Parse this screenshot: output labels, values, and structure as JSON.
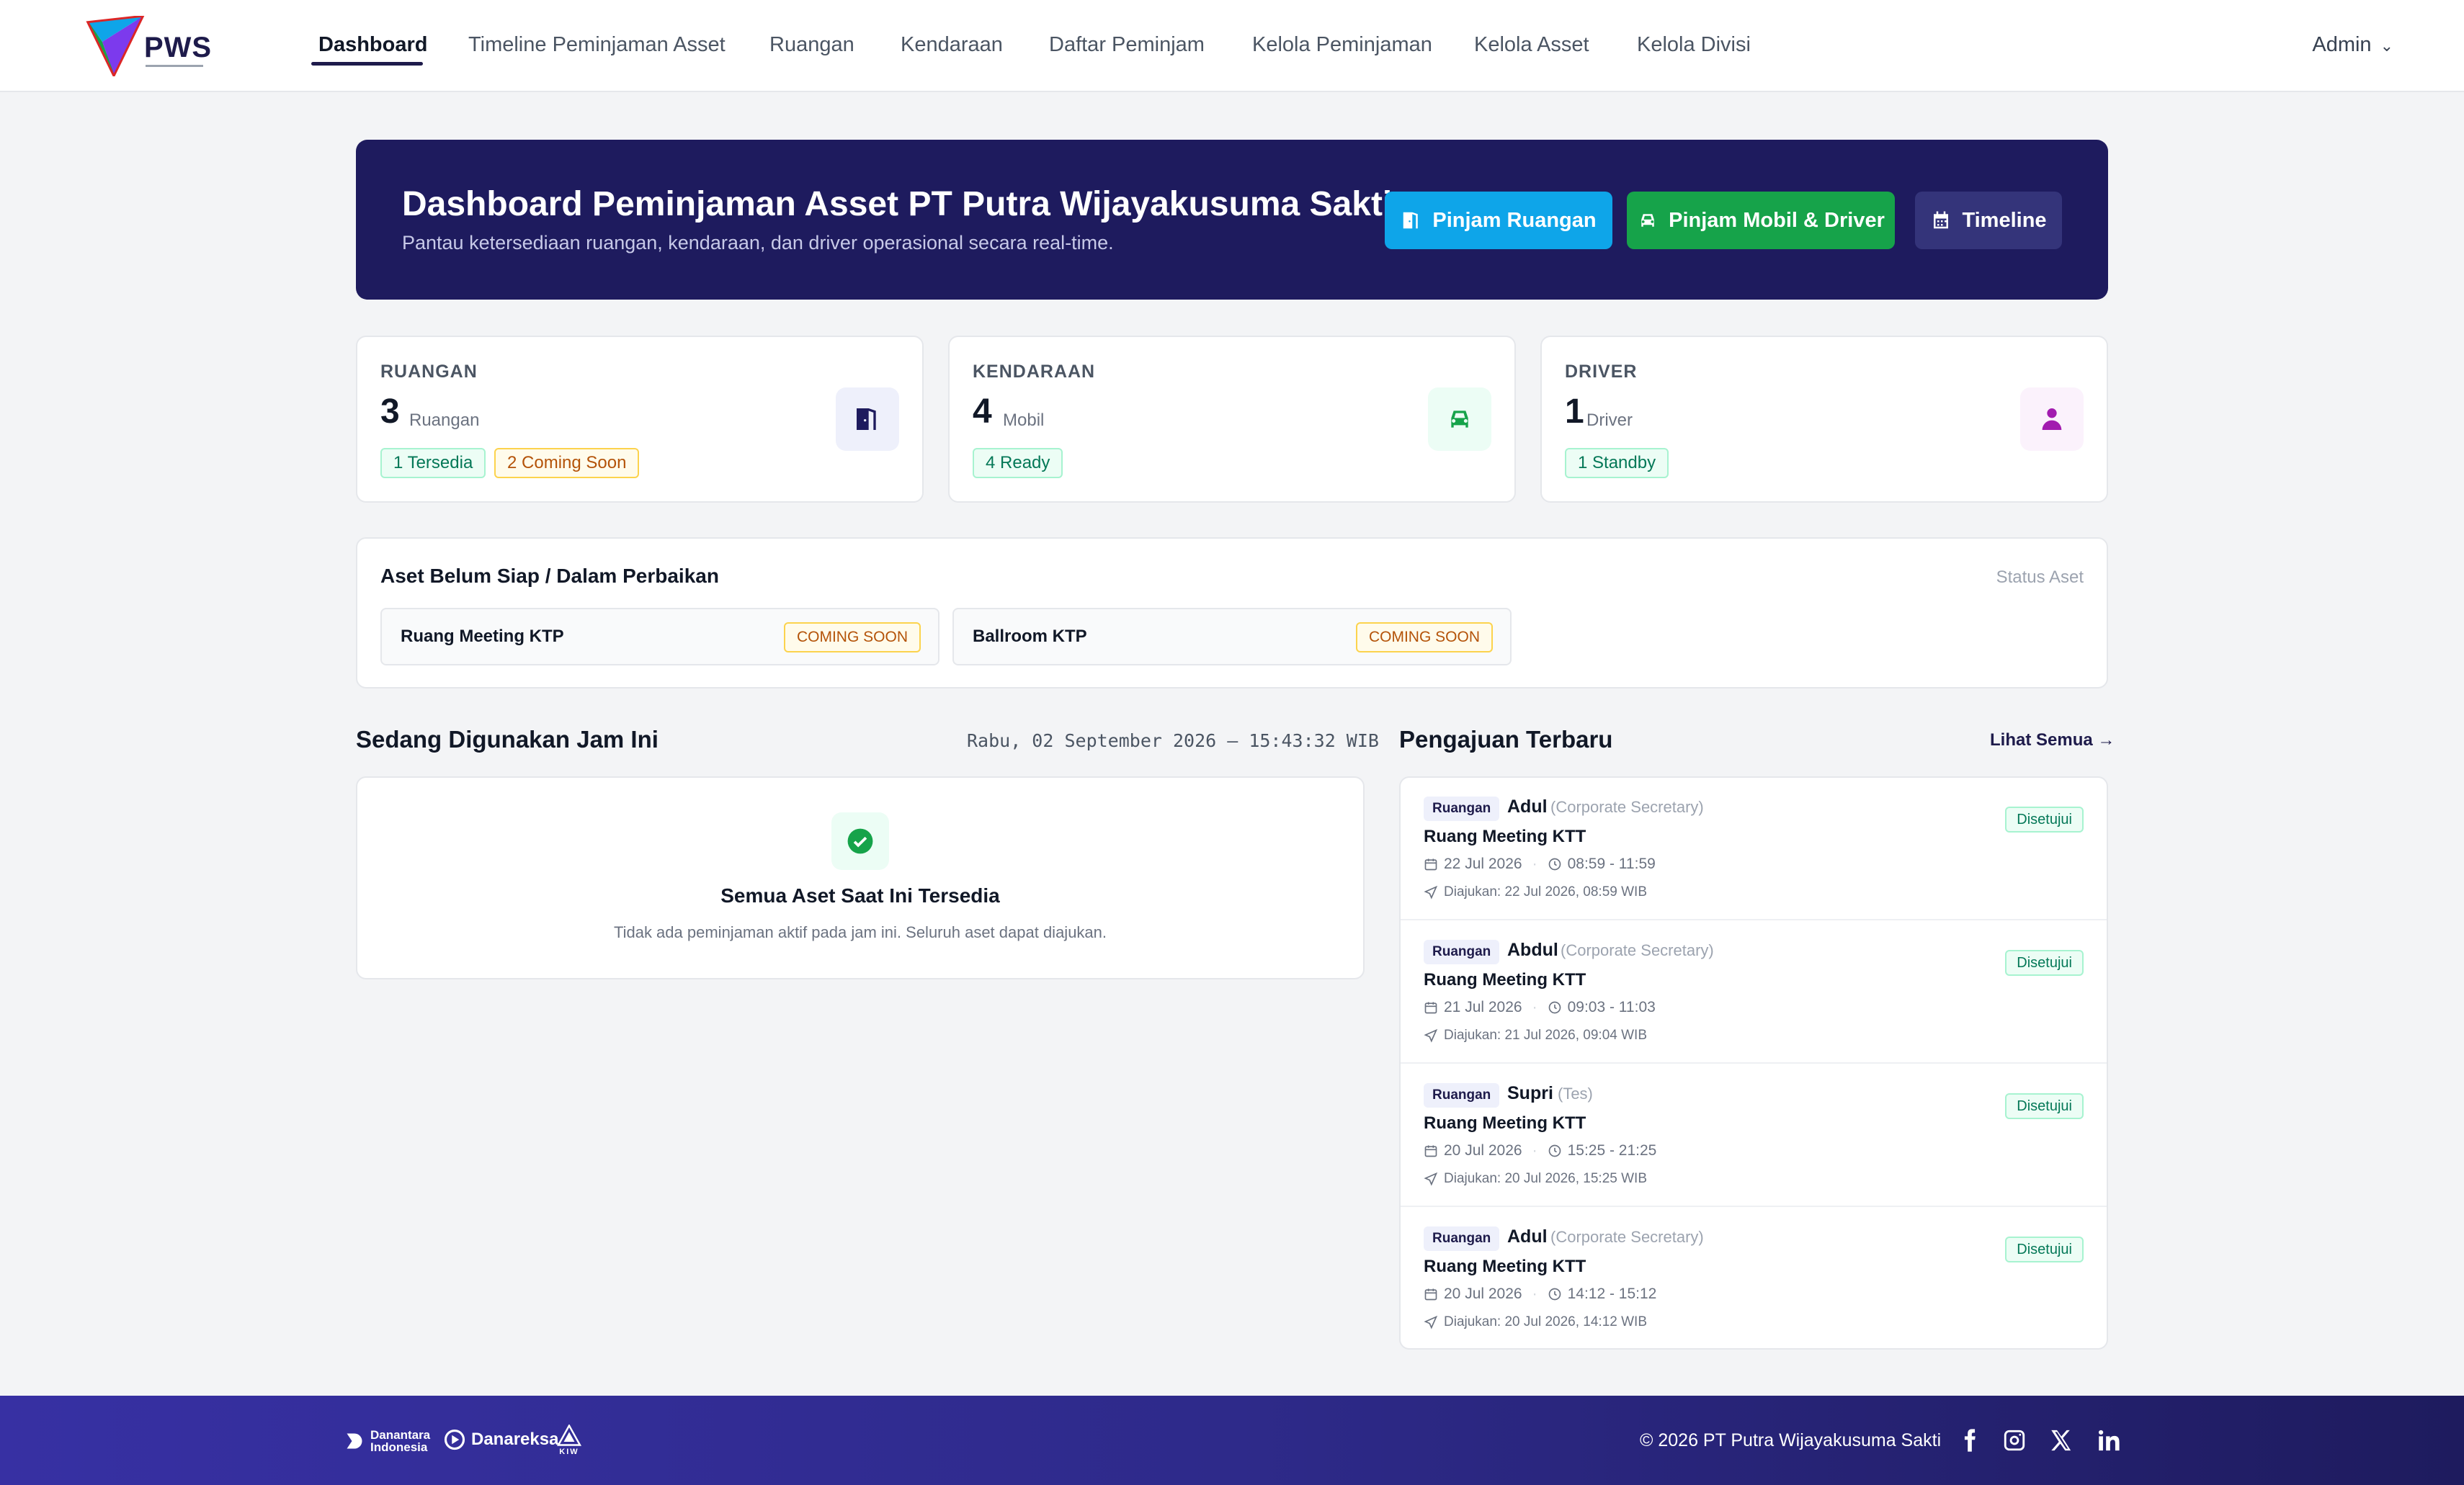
{
  "brand": {
    "name": "PWS"
  },
  "nav": {
    "items": [
      {
        "label": "Dashboard"
      },
      {
        "label": "Timeline Peminjaman Asset"
      },
      {
        "label": "Ruangan"
      },
      {
        "label": "Kendaraan"
      },
      {
        "label": "Daftar Peminjam"
      },
      {
        "label": "Kelola Peminjaman"
      },
      {
        "label": "Kelola Asset"
      },
      {
        "label": "Kelola Divisi"
      }
    ],
    "active": "Dashboard",
    "user": "Admin"
  },
  "hero": {
    "title": "Dashboard Peminjaman Asset PT Putra Wijayakusuma Sakti",
    "subtitle": "Pantau ketersediaan ruangan, kendaraan, dan driver operasional secara real-time.",
    "buttons": {
      "room": "Pinjam Ruangan",
      "car": "Pinjam Mobil & Driver",
      "timeline": "Timeline"
    }
  },
  "stats": [
    {
      "label": "RUANGAN",
      "count": "3",
      "unit": "Ruangan",
      "badges": [
        "1 Tersedia",
        "2 Coming Soon"
      ],
      "icon": "door-icon"
    },
    {
      "label": "KENDARAAN",
      "count": "4",
      "unit": "Mobil",
      "badges": [
        "4 Ready"
      ],
      "icon": "car-icon"
    },
    {
      "label": "DRIVER",
      "count": "1",
      "unit": "Driver",
      "badges": [
        "1 Standby"
      ],
      "icon": "person-icon"
    }
  ],
  "not_ready": {
    "title": "Aset Belum Siap / Dalam Perbaikan",
    "right_label": "Status Aset",
    "items": [
      {
        "name": "Ruang Meeting KTP",
        "status": "COMING SOON"
      },
      {
        "name": "Ballroom KTP",
        "status": "COMING SOON"
      }
    ]
  },
  "in_use": {
    "title": "Sedang Digunakan Jam Ini",
    "clock": "Rabu, 02 September 2026 — 15:43:32 WIB",
    "empty_title": "Semua Aset Saat Ini Tersedia",
    "empty_text": "Tidak ada peminjaman aktif pada jam ini. Seluruh aset dapat diajukan."
  },
  "recent": {
    "title": "Pengajuan Terbaru",
    "see_all": "Lihat Semua →",
    "items": [
      {
        "type": "Ruangan",
        "name": "Adul",
        "division": "(Corporate Secretary)",
        "room": "Ruang Meeting KTT",
        "date": "22 Jul 2026",
        "time": "08:59 - 11:59",
        "submitted": "Diajukan: 22 Jul 2026, 08:59 WIB",
        "status": "Disetujui"
      },
      {
        "type": "Ruangan",
        "name": "Abdul",
        "division": "(Corporate Secretary)",
        "room": "Ruang Meeting KTT",
        "date": "21 Jul 2026",
        "time": "09:03 - 11:03",
        "submitted": "Diajukan: 21 Jul 2026, 09:04 WIB",
        "status": "Disetujui"
      },
      {
        "type": "Ruangan",
        "name": "Supri",
        "division": "(Tes)",
        "room": "Ruang Meeting KTT",
        "date": "20 Jul 2026",
        "time": "15:25 - 21:25",
        "submitted": "Diajukan: 20 Jul 2026, 15:25 WIB",
        "status": "Disetujui"
      },
      {
        "type": "Ruangan",
        "name": "Adul",
        "division": "(Corporate Secretary)",
        "room": "Ruang Meeting KTT",
        "date": "20 Jul 2026",
        "time": "14:12 - 15:12",
        "submitted": "Diajukan: 20 Jul 2026, 14:12 WIB",
        "status": "Disetujui"
      }
    ]
  },
  "footer": {
    "partners": [
      "Danantara Indonesia",
      "Danareksa",
      "KIW"
    ],
    "copyright": "© 2026 PT Putra Wijayakusuma Sakti",
    "social": [
      "facebook-icon",
      "instagram-icon",
      "x-icon",
      "linkedin-icon"
    ]
  },
  "colors": {
    "primary": "#1e1b5e",
    "sky": "#0ea5e9",
    "green": "#16a34a",
    "success": "#047857",
    "warning": "#b45309"
  }
}
